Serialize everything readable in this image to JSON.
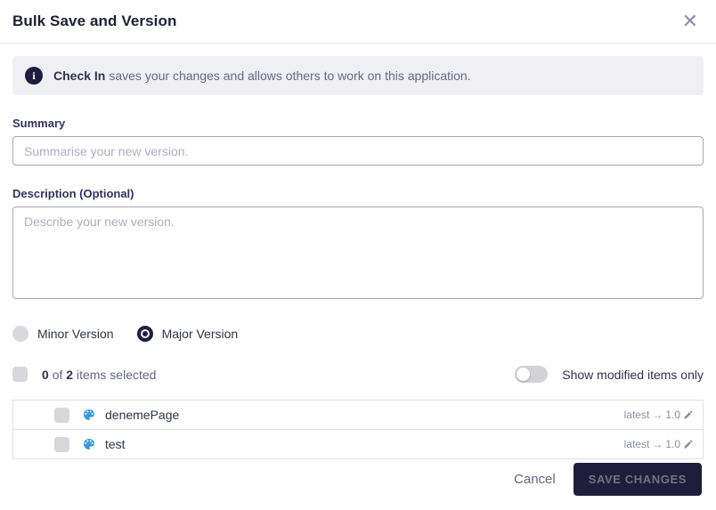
{
  "modal": {
    "title": "Bulk Save and Version",
    "close_glyph": "✕"
  },
  "banner": {
    "bold_text": "Check In",
    "text": "saves your changes and allows others to work on this application."
  },
  "summary": {
    "label": "Summary",
    "value": "",
    "placeholder": "Summarise your new version."
  },
  "description": {
    "label": "Description (Optional)",
    "value": "",
    "placeholder": "Describe your new version."
  },
  "version_options": {
    "minor": {
      "label": "Minor Version",
      "selected": false,
      "disabled": true
    },
    "major": {
      "label": "Major Version",
      "selected": true
    }
  },
  "selection": {
    "count": "0",
    "of_word": "of",
    "total": "2",
    "suffix": "items selected"
  },
  "toggle": {
    "label": "Show modified items only",
    "state": "off"
  },
  "items": [
    {
      "name": "denemePage",
      "version_from": "latest",
      "arrow": "→",
      "version_to": "1.0"
    },
    {
      "name": "test",
      "version_from": "latest",
      "arrow": "→",
      "version_to": "1.0"
    }
  ],
  "footer": {
    "cancel_label": "Cancel",
    "save_label": "SAVE CHANGES"
  },
  "colors": {
    "accent_dark_navy": "#1e1e3f",
    "label_indigo": "#32325d",
    "muted_gray": "#666687",
    "light_gray_text": "#8e8ea9",
    "banner_bg": "#f0f0f4",
    "item_icon_blue": "#3d9bd9",
    "border_gray": "#e0e0e8"
  }
}
